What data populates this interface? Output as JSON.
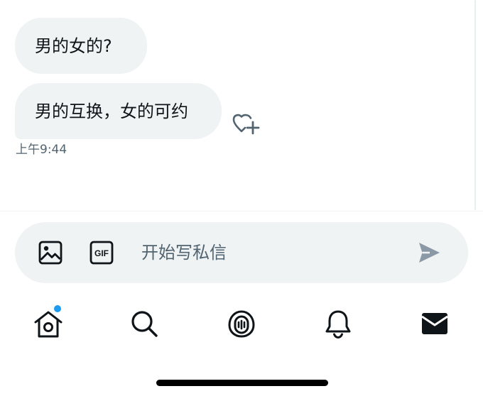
{
  "conversation": {
    "messages": [
      {
        "text": "男的女的?"
      },
      {
        "text": "男的互换，女的可约"
      }
    ],
    "last_timestamp": "上午9:44"
  },
  "composer": {
    "placeholder": "开始写私信",
    "gif_label": "GIF"
  },
  "tabbar": {
    "items": [
      {
        "icon": "home-icon",
        "has_unread_dot": true
      },
      {
        "icon": "search-icon"
      },
      {
        "icon": "spaces-icon"
      },
      {
        "icon": "bell-icon"
      },
      {
        "icon": "mail-icon",
        "active": true
      }
    ]
  },
  "colors": {
    "bubble_bg": "#eff3f4",
    "text": "#0f1419",
    "secondary_text": "#536471",
    "accent": "#1d9bf0",
    "send_icon": "#8b98a5"
  }
}
